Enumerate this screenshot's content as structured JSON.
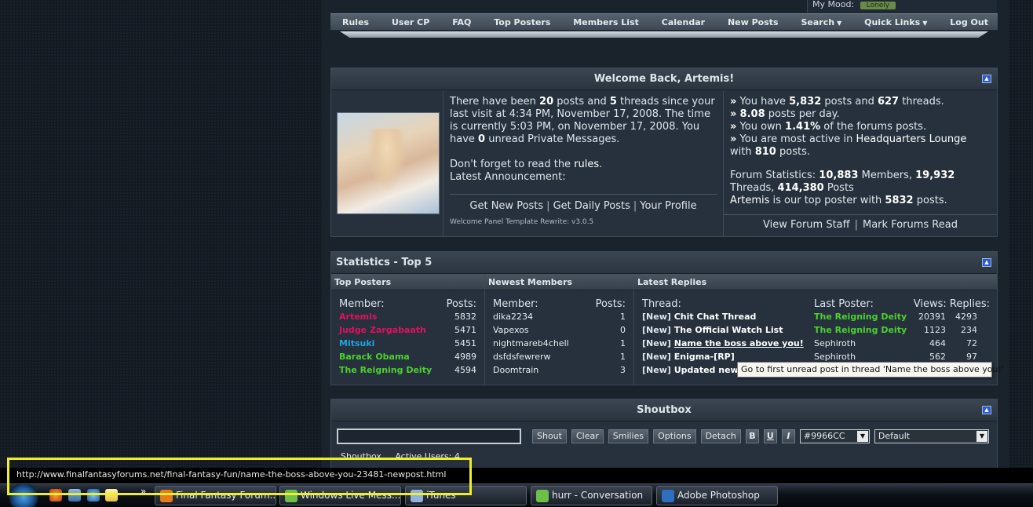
{
  "top": {
    "mood_label": "My Mood:",
    "mood_value": "Lonely"
  },
  "nav": [
    "Rules",
    "User CP",
    "FAQ",
    "Top Posters",
    "Members List",
    "Calendar",
    "New Posts",
    "Search",
    "Quick Links",
    "Log Out"
  ],
  "nav_dropdowns": {
    "search": "▼",
    "quick_links": "▼"
  },
  "welcome": {
    "title": "Welcome Back, Artemis!",
    "mid_p1_a": "There have been ",
    "posts_since": "20",
    "mid_p1_b": " posts and ",
    "threads_since": "5",
    "mid_p1_c": " threads since your last visit at 4:34 PM, November 17, 2008. The time is currently 5:03 PM, on November 17, 2008. You have ",
    "unread_pm": "0",
    "mid_p1_d": " unread Private Messages.",
    "rules_prefix": "Don't forget to read the ",
    "rules_link": "rules",
    "rules_suffix": ".",
    "announcement": "Latest Announcement:",
    "links": [
      "Get New Posts",
      "Get Daily Posts",
      "Your Profile"
    ],
    "version": "Welcome Panel Template Rewrite: v3.0.5",
    "r1_a": "You have ",
    "user_posts": "5,832",
    "r1_b": " posts and ",
    "user_threads": "627",
    "r1_c": " threads.",
    "r2_val": "8.08",
    "r2_b": " posts per day.",
    "r3_a": "You own ",
    "r3_val": "1.41%",
    "r3_b": " of the forums posts.",
    "r4_a": "You are most active in ",
    "r4_forum": "Headquarters Lounge",
    "r4_b": " with ",
    "r4_val": "810",
    "r4_c": " posts.",
    "fs_label": "Forum Statistics: ",
    "members": "10,883",
    "fs_members": " Members, ",
    "threads": "19,932",
    "fs_threads": " Threads, ",
    "posts": "414,380",
    "fs_posts": " Posts",
    "top_poster": "Artemis",
    "top_text": " is our top poster with ",
    "top_count": "5832",
    "top_suffix": " posts.",
    "staff_links": [
      "View Forum Staff",
      "Mark Forums Read"
    ],
    "separator": "|"
  },
  "stats": {
    "title": "Statistics - Top 5",
    "top_posters": {
      "header": "Top Posters",
      "col_member": "Member:",
      "col_posts": "Posts:",
      "rows": [
        {
          "name": "Artemis",
          "posts": "5832",
          "color": "#e0115f"
        },
        {
          "name": "Judge Zargabaath",
          "posts": "5471",
          "color": "#e0115f"
        },
        {
          "name": "Mitsuki",
          "posts": "5451",
          "color": "#1fa3e0"
        },
        {
          "name": "Barack Obama",
          "posts": "4989",
          "color": "#4bd12e"
        },
        {
          "name": "The Reigning Deity",
          "posts": "4594",
          "color": "#4bd12e"
        }
      ]
    },
    "newest": {
      "header": "Newest Members",
      "col_member": "Member:",
      "col_posts": "Posts:",
      "rows": [
        {
          "name": "dika2234",
          "posts": "1"
        },
        {
          "name": "Vapexos",
          "posts": "0"
        },
        {
          "name": "nightmareb4chell",
          "posts": "1"
        },
        {
          "name": "dsfdsfewrerw",
          "posts": "1"
        },
        {
          "name": "Doomtrain",
          "posts": "3"
        }
      ]
    },
    "replies": {
      "header": "Latest Replies",
      "col_thread": "Thread:",
      "col_last": "Last Poster:",
      "col_vr": "Views: Replies:",
      "new_tag": "[New]",
      "rows": [
        {
          "thread": "Chit Chat Thread",
          "poster": "The Reigning Deity",
          "poster_color": "#4bd12e",
          "views": "20391",
          "replies": "4293"
        },
        {
          "thread": "The Official Watch List",
          "poster": "The Reigning Deity",
          "poster_color": "#4bd12e",
          "views": "1123",
          "replies": "234"
        },
        {
          "thread": "Name the boss above you!",
          "poster": "Sephiroth",
          "poster_color": "#e6ebf0",
          "views": "464",
          "replies": "72"
        },
        {
          "thread": "Enigma-[RP]",
          "poster": "Sephiroth",
          "poster_color": "#e6ebf0",
          "views": "562",
          "replies": "97"
        },
        {
          "thread": "Updated new",
          "poster": "",
          "poster_color": "#e6ebf0",
          "views": "",
          "replies": ""
        }
      ]
    },
    "tooltip": "Go to first unread post in thread 'Name the boss above you!'"
  },
  "shoutbox": {
    "title": "Shoutbox",
    "buttons": [
      "Shout",
      "Clear",
      "Smilies",
      "Options",
      "Detach"
    ],
    "format": [
      "B",
      "U",
      "I"
    ],
    "color_value": "#9966CC",
    "font_value": "Default",
    "tabs": "Shoutbox     Active Users: 4"
  },
  "statusbar_url": "http://www.finalfantasyforums.net/final-fantasy-fun/name-the-boss-above-you-23481-newpost.html",
  "taskbar": {
    "overflow": "»",
    "items": [
      {
        "label": "Final Fantasy Forum...",
        "icon_color": "#e87a1e"
      },
      {
        "label": "Windows Live Mess...",
        "icon_color": "#6cc04a"
      },
      {
        "label": "iTunes",
        "icon_color": "#8fb2e0"
      },
      {
        "label": "hurr  - Conversation",
        "icon_color": "#6cc04a"
      },
      {
        "label": "Adobe Photoshop",
        "icon_color": "#2e6fc0"
      }
    ]
  },
  "colors": {
    "highlight": "#f0ee2a",
    "accent_blue": "#2d5cc9"
  }
}
